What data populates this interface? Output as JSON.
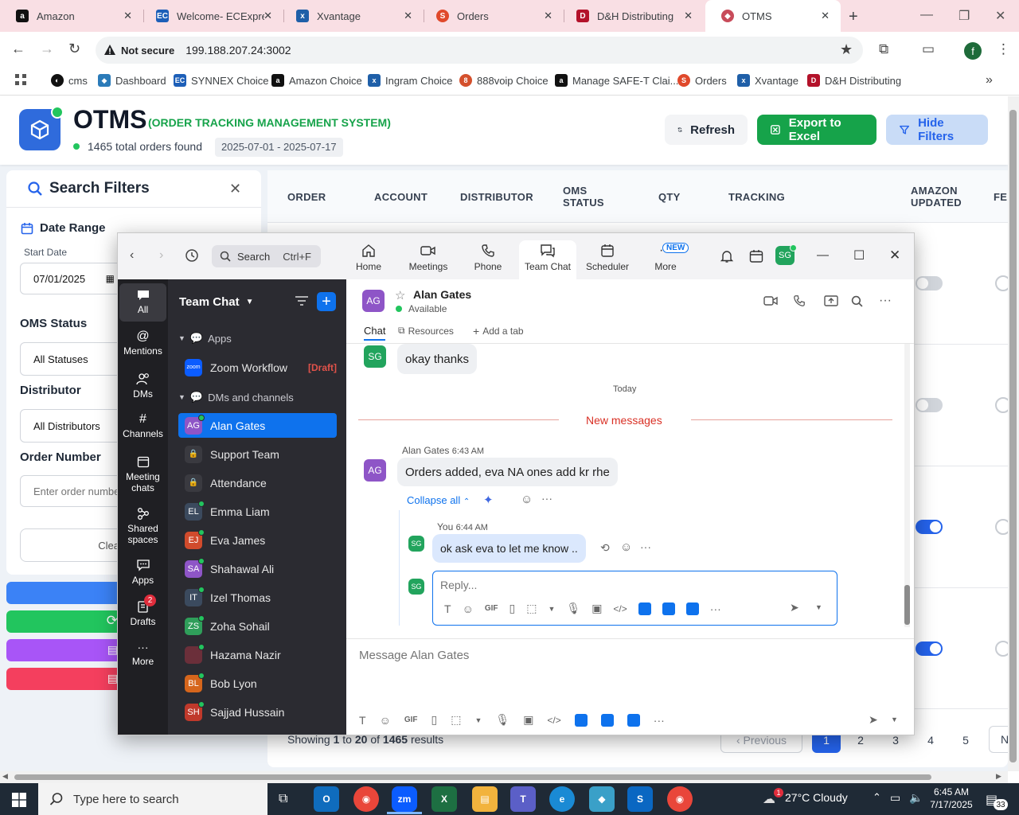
{
  "browser": {
    "tabs": [
      {
        "label": "Amazon",
        "icon": "amazon-icon"
      },
      {
        "label": "Welcome- ECExpress",
        "icon": "ecexpress-icon"
      },
      {
        "label": "Xvantage",
        "icon": "xvantage-icon"
      },
      {
        "label": "Orders",
        "icon": "orders-icon"
      },
      {
        "label": "D&H Distributing",
        "icon": "dh-icon"
      },
      {
        "label": "OTMS",
        "icon": "otms-icon"
      }
    ],
    "security_label": "Not secure",
    "url": "199.188.207.24:3002",
    "profile_initial": "f",
    "bookmarks": [
      "cms",
      "Dashboard",
      "SYNNEX Choice",
      "Amazon Choice",
      "Ingram Choice",
      "888voip Choice",
      "Manage SAFE-T Clai...",
      "Orders",
      "Xvantage",
      "D&H Distributing"
    ]
  },
  "otms": {
    "title": "OTMS",
    "subtitle": "(ORDER TRACKING MANAGEMENT SYSTEM)",
    "total_orders": "1465 total orders found",
    "date_range": "2025-07-01 - 2025-07-17",
    "buttons": {
      "refresh": "Refresh",
      "export": "Export to Excel",
      "hide_filters": "Hide Filters"
    },
    "filters": {
      "title": "Search Filters",
      "date_range_label": "Date Range",
      "start_date_label": "Start Date",
      "start_date_value": "07/01/2025",
      "oms_status_label": "OMS Status",
      "oms_status_value": "All Statuses",
      "distributor_label": "Distributor",
      "distributor_value": "All Distributors",
      "order_number_label": "Order Number",
      "order_number_placeholder": "Enter order number",
      "clear_label": "Clea"
    },
    "table": {
      "columns": [
        "ORDER",
        "ACCOUNT",
        "DISTRIBUTOR",
        "OMS STATUS",
        "QTY",
        "TRACKING",
        "AMAZON UPDATED",
        "FEE"
      ],
      "amazon_updated_toggles": [
        false,
        false,
        true,
        true
      ]
    },
    "pagination": {
      "summary_prefix": "Showing ",
      "from": "1",
      "summary_to": " to ",
      "to": "20",
      "summary_of": " of ",
      "total": "1465",
      "summary_suffix": " results",
      "previous": "Previous",
      "pages": [
        "1",
        "2",
        "3",
        "4",
        "5"
      ],
      "current": "1",
      "next": "N"
    }
  },
  "zoom": {
    "search_label": "Search",
    "search_shortcut": "Ctrl+F",
    "nav_tabs": [
      "Home",
      "Meetings",
      "Phone",
      "Team Chat",
      "Scheduler",
      "More"
    ],
    "new_badge": "NEW",
    "user_initials": "SG",
    "rail": [
      {
        "label": "All",
        "icon": "chat-bubble-icon"
      },
      {
        "label": "Mentions",
        "icon": "at-icon"
      },
      {
        "label": "DMs",
        "icon": "people-icon"
      },
      {
        "label": "Channels",
        "icon": "hash-icon"
      },
      {
        "label": "Meeting chats",
        "icon": "calendar-icon"
      },
      {
        "label": "Shared spaces",
        "icon": "share-icon"
      },
      {
        "label": "Apps",
        "icon": "apps-icon"
      },
      {
        "label": "Drafts",
        "icon": "drafts-icon",
        "badge": "2"
      },
      {
        "label": "More",
        "icon": "more-icon"
      }
    ],
    "list_title": "Team Chat",
    "section_apps": "Apps",
    "zoom_workflow": "Zoom Workflow",
    "zoom_workflow_badge": "[Draft]",
    "section_dms": "DMs and channels",
    "contacts": [
      {
        "name": "Alan Gates",
        "initials": "AG",
        "color": "#8e55c7",
        "online": true,
        "active": true
      },
      {
        "name": "Support Team",
        "initials": "",
        "color": "#3a3a40",
        "locked": true
      },
      {
        "name": "Attendance",
        "initials": "",
        "color": "#3a3a40",
        "locked": true
      },
      {
        "name": "Emma Liam",
        "initials": "EL",
        "color": "#3b4a5e",
        "online": true
      },
      {
        "name": "Eva James",
        "initials": "EJ",
        "color": "#d14b2c",
        "online": true
      },
      {
        "name": "Shahawal Ali",
        "initials": "SA",
        "color": "#8e55c7",
        "online": true
      },
      {
        "name": "Izel Thomas",
        "initials": "IT",
        "color": "#3b4a5e",
        "online": true
      },
      {
        "name": "Zoha Sohail",
        "initials": "ZS",
        "color": "#2f9e5a",
        "online": true
      },
      {
        "name": "Hazama Nazir",
        "initials": "",
        "color": "#6b2f3a",
        "online": true
      },
      {
        "name": "Bob Lyon",
        "initials": "BL",
        "color": "#d6661c",
        "online": true
      },
      {
        "name": "Sajjad Hussain",
        "initials": "SH",
        "color": "#c0392b",
        "online": true
      }
    ],
    "chat": {
      "contact_name": "Alan Gates",
      "contact_initials": "AG",
      "status": "Available",
      "tabs": [
        "Chat",
        "Resources",
        "Add a tab"
      ],
      "prev_message": "okay thanks",
      "day_divider": "Today",
      "new_messages": "New messages",
      "msg_author": "Alan Gates",
      "msg_time": "6:43 AM",
      "msg_text": "Orders added, eva NA ones add kr rhe",
      "collapse_all": "Collapse all",
      "reply_author": "You",
      "reply_time": "6:44 AM",
      "reply_text": "ok ask eva to let me know ..",
      "reply_placeholder": "Reply...",
      "composer_placeholder": "Message Alan Gates",
      "gif_label": "GIF"
    }
  },
  "taskbar": {
    "search_placeholder": "Type here to search",
    "weather": "27°C  Cloudy",
    "weather_badge": "1",
    "time": "6:45 AM",
    "date": "7/17/2025",
    "notif_count": "33"
  },
  "colors": {
    "otms_blue": "#2f6bdc",
    "otms_green": "#16a34a",
    "zoom_blue": "#0e72ed",
    "new_messages_red": "#d93025"
  }
}
